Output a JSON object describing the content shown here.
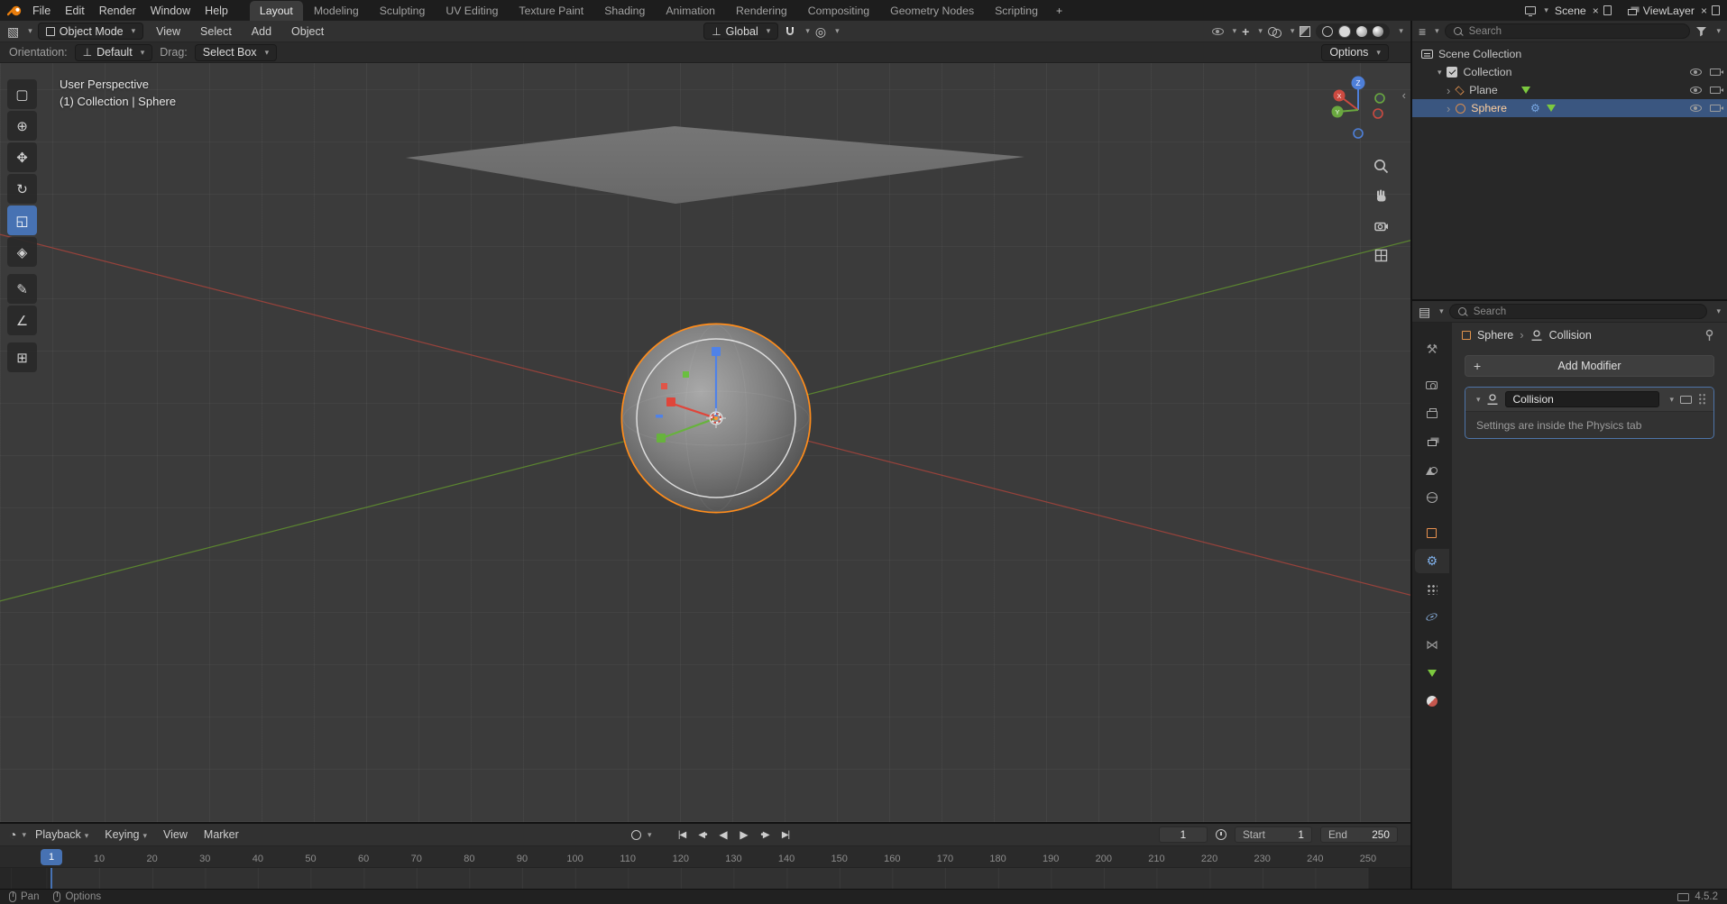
{
  "topbar": {
    "menus": [
      "File",
      "Edit",
      "Render",
      "Window",
      "Help"
    ],
    "tabs": [
      "Layout",
      "Modeling",
      "Sculpting",
      "UV Editing",
      "Texture Paint",
      "Shading",
      "Animation",
      "Rendering",
      "Compositing",
      "Geometry Nodes",
      "Scripting"
    ],
    "add_tab": "+",
    "scene_label": "Scene",
    "viewlayer_label": "ViewLayer"
  },
  "vp_header": {
    "mode": "Object Mode",
    "menus": [
      "View",
      "Select",
      "Add",
      "Object"
    ],
    "orientation": "Global"
  },
  "tool_settings": {
    "orientation_label": "Orientation:",
    "orientation_value": "Default",
    "drag_label": "Drag:",
    "drag_value": "Select Box",
    "options_label": "Options"
  },
  "viewport": {
    "perspective_label": "User Perspective",
    "context_label": "(1) Collection | Sphere",
    "axis": {
      "x": "X",
      "y": "Y",
      "z": "Z"
    }
  },
  "outliner": {
    "search_placeholder": "Search",
    "rows": [
      {
        "label": "Scene Collection"
      },
      {
        "label": "Collection"
      },
      {
        "label": "Plane"
      },
      {
        "label": "Sphere"
      }
    ]
  },
  "properties": {
    "search_placeholder": "Search",
    "breadcrumb": {
      "object": "Sphere",
      "item": "Collision"
    },
    "add_modifier_label": "Add Modifier",
    "modifier": {
      "name": "Collision",
      "info": "Settings are inside the Physics tab"
    }
  },
  "timeline": {
    "menus": [
      "Playback",
      "Keying",
      "View",
      "Marker"
    ],
    "current_frame": "1",
    "start_label": "Start",
    "start_value": "1",
    "end_label": "End",
    "end_value": "250",
    "ticks": [
      "10",
      "20",
      "30",
      "40",
      "50",
      "60",
      "70",
      "80",
      "90",
      "100",
      "110",
      "120",
      "130",
      "140",
      "150",
      "160",
      "170",
      "180",
      "190",
      "200",
      "210",
      "220",
      "230",
      "240",
      "250"
    ]
  },
  "statusbar": {
    "pan_label": "Pan",
    "options_label": "Options",
    "version": "4.5.2"
  },
  "colors": {
    "accent": "#4772b3",
    "selection": "#ff8d1c"
  }
}
